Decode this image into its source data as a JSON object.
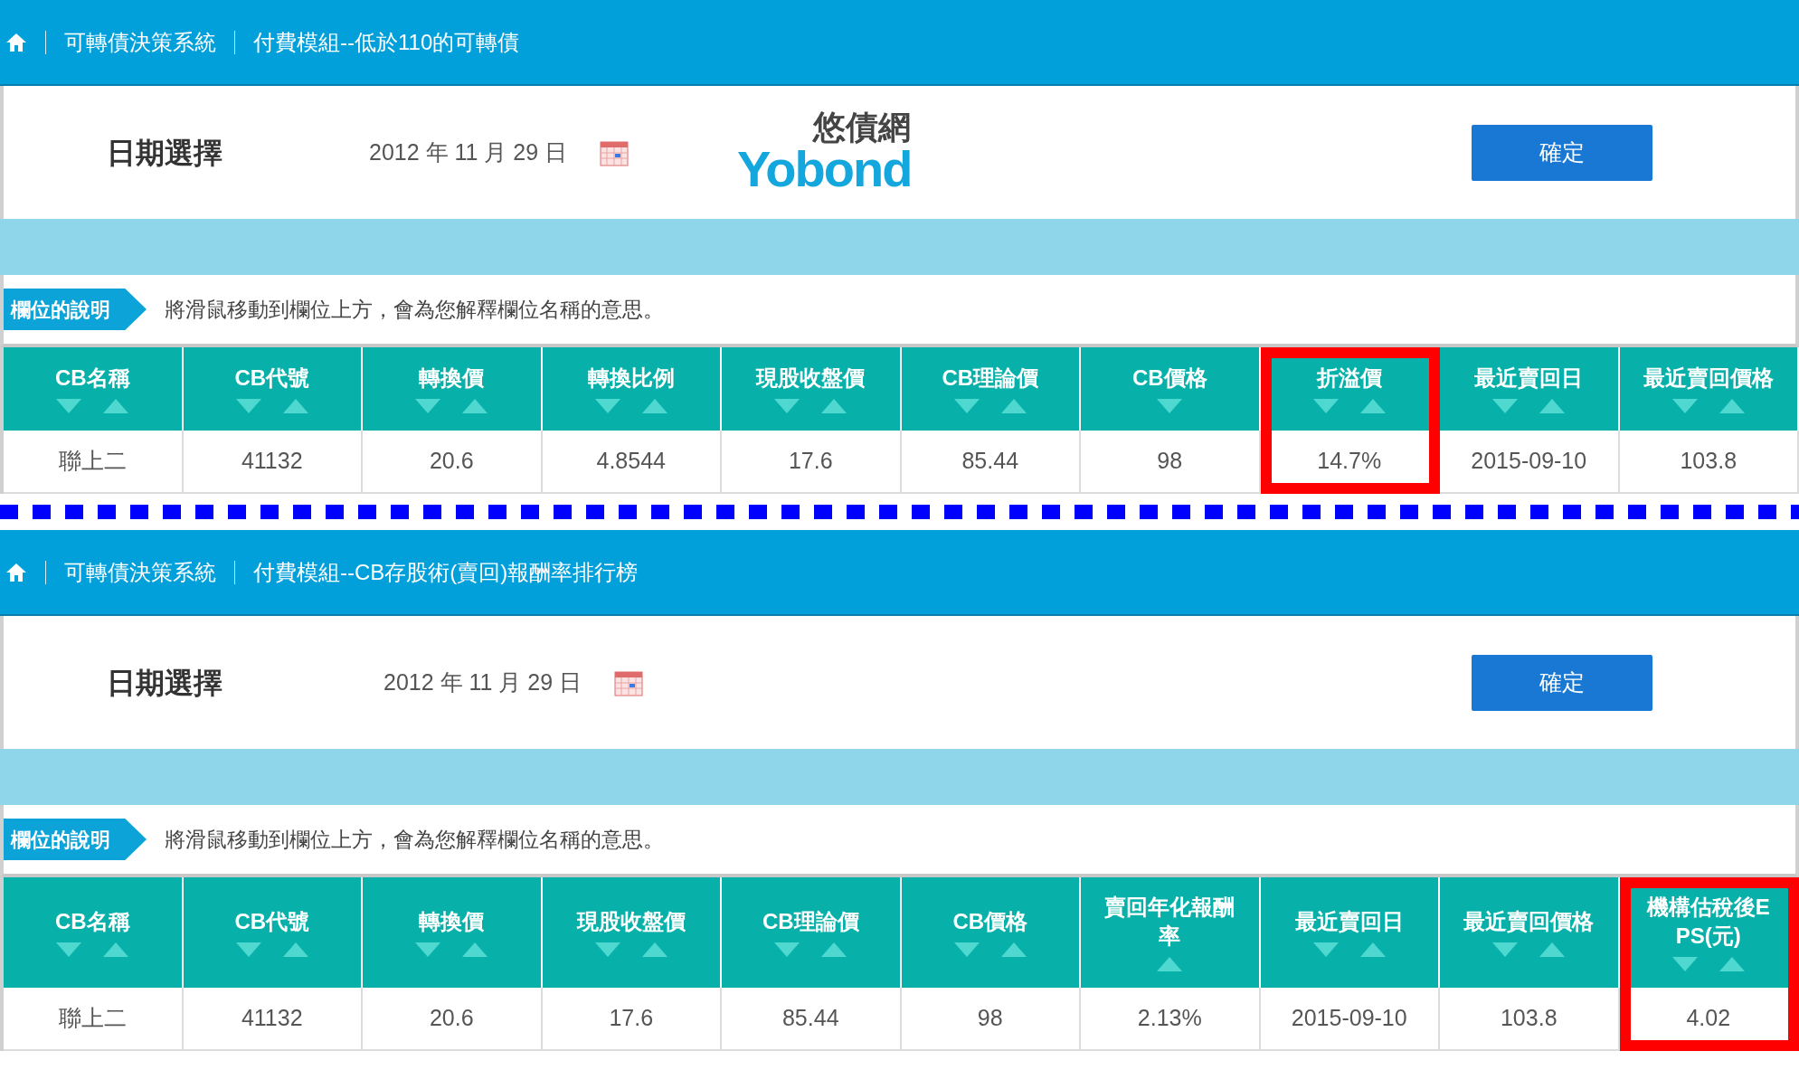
{
  "panels": [
    {
      "breadcrumb": [
        "可轉債決策系統",
        "付費模組--低於110的可轉債"
      ],
      "date_label": "日期選擇",
      "date_value": "2012 年 11 月 29 日",
      "logo": {
        "name": "悠債網",
        "wordmark": "Yobond"
      },
      "confirm_button": "確定",
      "info_tag": "欄位的說明",
      "info_text": "將滑鼠移動到欄位上方，會為您解釋欄位名稱的意思。",
      "columns": [
        {
          "label": "CB名稱",
          "sort_down": true,
          "sort_up": true,
          "highlighted": false
        },
        {
          "label": "CB代號",
          "sort_down": true,
          "sort_up": true,
          "highlighted": false
        },
        {
          "label": "轉換價",
          "sort_down": true,
          "sort_up": true,
          "highlighted": false
        },
        {
          "label": "轉換比例",
          "sort_down": true,
          "sort_up": true,
          "highlighted": false
        },
        {
          "label": "現股收盤價",
          "sort_down": true,
          "sort_up": true,
          "highlighted": false
        },
        {
          "label": "CB理論價",
          "sort_down": true,
          "sort_up": true,
          "highlighted": false
        },
        {
          "label": "CB價格",
          "sort_down": true,
          "sort_up": false,
          "highlighted": false
        },
        {
          "label": "折溢價",
          "sort_down": true,
          "sort_up": true,
          "highlighted": true
        },
        {
          "label": "最近賣回日",
          "sort_down": true,
          "sort_up": true,
          "highlighted": false
        },
        {
          "label": "最近賣回價格",
          "sort_down": true,
          "sort_up": true,
          "highlighted": false
        }
      ],
      "rows": [
        [
          "聯上二",
          "41132",
          "20.6",
          "4.8544",
          "17.6",
          "85.44",
          "98",
          "14.7%",
          "2015-09-10",
          "103.8"
        ]
      ]
    },
    {
      "breadcrumb": [
        "可轉債決策系統",
        "付費模組--CB存股術(賣回)報酬率排行榜"
      ],
      "date_label": "日期選擇",
      "date_value": "2012 年 11 月 29 日",
      "confirm_button": "確定",
      "info_tag": "欄位的說明",
      "info_text": "將滑鼠移動到欄位上方，會為您解釋欄位名稱的意思。",
      "columns": [
        {
          "label": "CB名稱",
          "sort_down": true,
          "sort_up": true,
          "highlighted": false
        },
        {
          "label": "CB代號",
          "sort_down": true,
          "sort_up": true,
          "highlighted": false
        },
        {
          "label": "轉換價",
          "sort_down": true,
          "sort_up": true,
          "highlighted": false
        },
        {
          "label": "現股收盤價",
          "sort_down": true,
          "sort_up": true,
          "highlighted": false
        },
        {
          "label": "CB理論價",
          "sort_down": true,
          "sort_up": true,
          "highlighted": false
        },
        {
          "label": "CB價格",
          "sort_down": true,
          "sort_up": true,
          "highlighted": false
        },
        {
          "label": "賣回年化報酬率",
          "sort_down": false,
          "sort_up": true,
          "highlighted": false
        },
        {
          "label": "最近賣回日",
          "sort_down": true,
          "sort_up": true,
          "highlighted": false
        },
        {
          "label": "最近賣回價格",
          "sort_down": true,
          "sort_up": true,
          "highlighted": false
        },
        {
          "label": "機構估稅後EPS(元)",
          "sort_down": true,
          "sort_up": true,
          "highlighted": true
        }
      ],
      "rows": [
        [
          "聯上二",
          "41132",
          "20.6",
          "17.6",
          "85.44",
          "98",
          "2.13%",
          "2015-09-10",
          "103.8",
          "4.02"
        ]
      ]
    }
  ]
}
